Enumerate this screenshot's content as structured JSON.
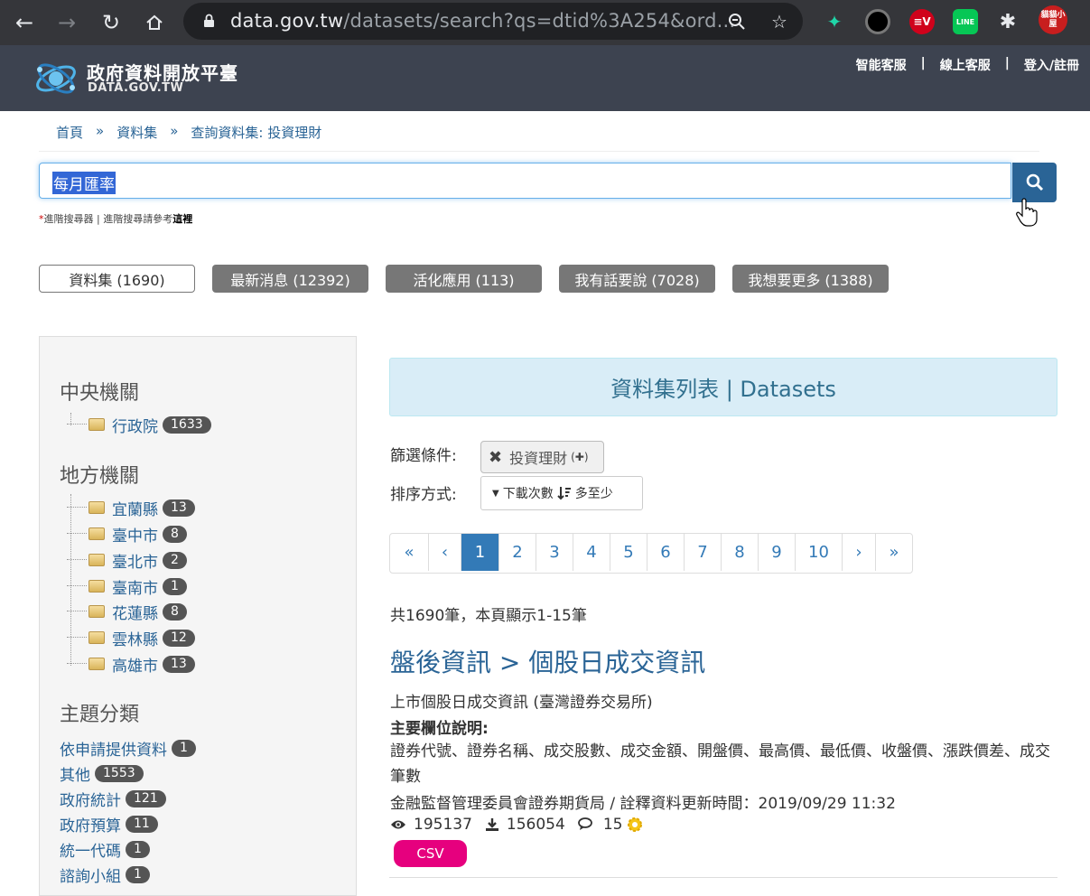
{
  "browser": {
    "url_host": "data.gov.tw",
    "url_rest": "/datasets/search?qs=dtid%3A254&ord...",
    "extensions": [
      "ext-green-icon",
      "ext-black-circle-icon",
      "ext-expressvpn-icon",
      "ext-line-icon",
      "extensions-puzzle-icon"
    ],
    "line_label": "LINE",
    "profile_label": "貓貓小屋"
  },
  "site": {
    "logo_zh": "政府資料開放平臺",
    "logo_en": "DATA.GOV.TW",
    "toplinks": [
      "智能客服",
      "|",
      "線上客服",
      "|",
      "登入/註冊"
    ]
  },
  "breadcrumb": [
    "首頁",
    "»",
    "資料集",
    "»",
    "查詢資料集: 投資理財"
  ],
  "search": {
    "value": "每月匯率",
    "advanced_star": "*",
    "advanced_text": "進階搜尋器 | 進階搜尋請參考",
    "advanced_link": "這裡"
  },
  "tabs": [
    {
      "label": "資料集 (1690)",
      "active": true
    },
    {
      "label": "最新消息 (12392)",
      "active": false
    },
    {
      "label": "活化應用 (113)",
      "active": false
    },
    {
      "label": "我有話要說 (7028)",
      "active": false
    },
    {
      "label": "我想要更多 (1388)",
      "active": false
    }
  ],
  "sidebar": {
    "central_title": "中央機關",
    "central": [
      {
        "label": "行政院",
        "count": "1633"
      }
    ],
    "local_title": "地方機關",
    "local": [
      {
        "label": "宜蘭縣",
        "count": "13"
      },
      {
        "label": "臺中市",
        "count": "8"
      },
      {
        "label": "臺北市",
        "count": "2"
      },
      {
        "label": "臺南市",
        "count": "1"
      },
      {
        "label": "花蓮縣",
        "count": "8"
      },
      {
        "label": "雲林縣",
        "count": "12"
      },
      {
        "label": "高雄市",
        "count": "13"
      }
    ],
    "topic_title": "主題分類",
    "topics": [
      {
        "label": "依申請提供資料",
        "count": "1"
      },
      {
        "label": "其他",
        "count": "1553"
      },
      {
        "label": "政府統計",
        "count": "121"
      },
      {
        "label": "政府預算",
        "count": "11"
      },
      {
        "label": "統一代碼",
        "count": "1"
      },
      {
        "label": "諮詢小組",
        "count": "1"
      }
    ]
  },
  "main": {
    "panel_title": "資料集列表 | Datasets",
    "filter_label": "篩選條件:",
    "filter_chip": "投資理財",
    "sort_label": "排序方式:",
    "sort_field": "下載次數",
    "sort_order": "多至少",
    "pager": [
      "«",
      "‹",
      "1",
      "2",
      "3",
      "4",
      "5",
      "6",
      "7",
      "8",
      "9",
      "10",
      "›",
      "»"
    ],
    "pager_active": "1",
    "count_text": "共1690筆，本頁顯示1-15筆",
    "dataset": {
      "title": "盤後資訊 > 個股日成交資訊",
      "desc": "上市個股日成交資訊 (臺灣證券交易所)",
      "fields_label": "主要欄位說明:",
      "fields": "證券代號、證券名稱、成交股數、成交金額、開盤價、最高價、最低價、收盤價、漲跌價差、成交筆數",
      "agency": "金融監督管理委員會證券期貨局 / 詮釋資料更新時間：2019/09/29 11:32",
      "views": "195137",
      "downloads": "156054",
      "comments": "15",
      "format": "CSV"
    }
  }
}
